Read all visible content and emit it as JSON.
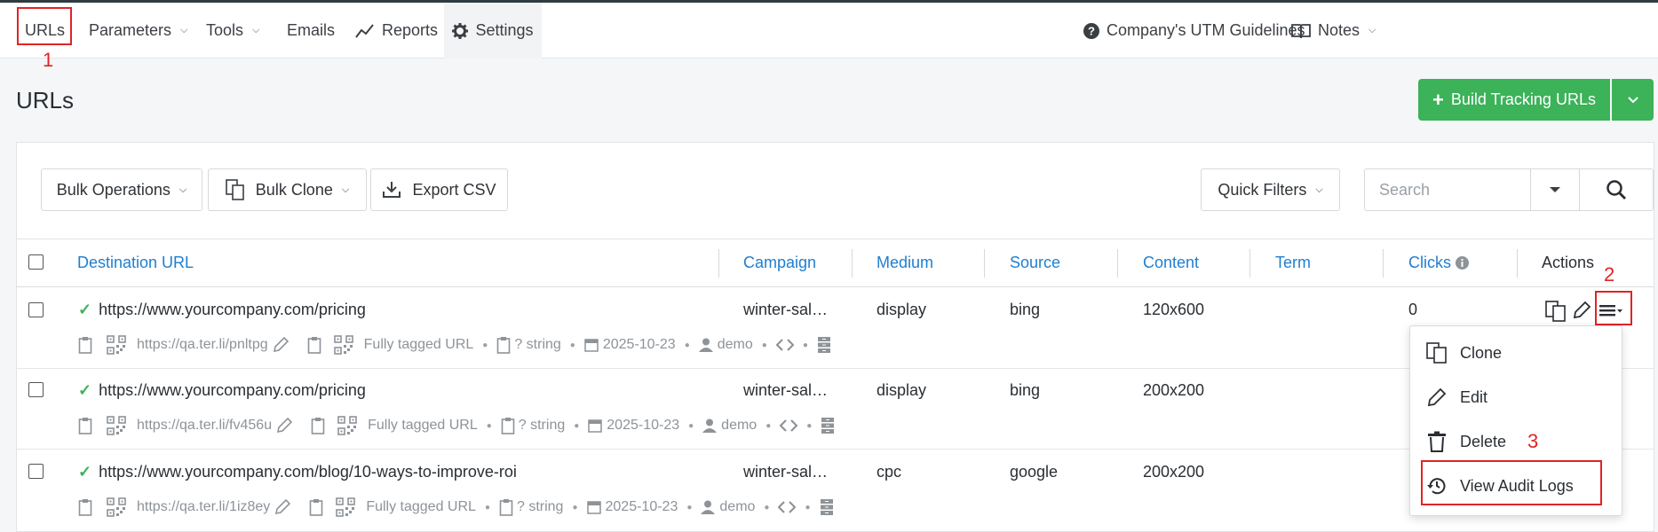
{
  "nav": {
    "urls": "URLs",
    "parameters": "Parameters",
    "tools": "Tools",
    "emails": "Emails",
    "reports": "Reports",
    "settings": "Settings",
    "guidelines": "Company's UTM Guidelines",
    "notes": "Notes"
  },
  "annotations": {
    "n1": "1",
    "n2": "2",
    "n3": "3"
  },
  "page": {
    "title": "URLs",
    "build_label": "Build Tracking URLs"
  },
  "toolbar": {
    "bulk_operations": "Bulk Operations",
    "bulk_clone": "Bulk Clone",
    "export_csv": "Export CSV",
    "quick_filters": "Quick Filters",
    "search_placeholder": "Search"
  },
  "table": {
    "headers": {
      "destination": "Destination URL",
      "campaign": "Campaign",
      "medium": "Medium",
      "source": "Source",
      "content": "Content",
      "term": "Term",
      "clicks": "Clicks",
      "actions": "Actions"
    },
    "rows": [
      {
        "url": "https://www.yourcompany.com/pricing",
        "campaign": "winter-sal…",
        "medium": "display",
        "source": "bing",
        "content": "120x600",
        "term": "",
        "clicks": "0",
        "short": "https://qa.ter.li/pnltpg",
        "tag": "Fully tagged URL",
        "type": "? string",
        "date": "2025-10-23",
        "user": "demo"
      },
      {
        "url": "https://www.yourcompany.com/pricing",
        "campaign": "winter-sal…",
        "medium": "display",
        "source": "bing",
        "content": "200x200",
        "term": "",
        "clicks": "",
        "short": "https://qa.ter.li/fv456u",
        "tag": "Fully tagged URL",
        "type": "? string",
        "date": "2025-10-23",
        "user": "demo"
      },
      {
        "url": "https://www.yourcompany.com/blog/10-ways-to-improve-roi",
        "campaign": "winter-sal…",
        "medium": "cpc",
        "source": "google",
        "content": "200x200",
        "term": "",
        "clicks": "",
        "short": "https://qa.ter.li/1iz8ey",
        "tag": "Fully tagged URL",
        "type": "? string",
        "date": "2025-10-23",
        "user": "demo"
      }
    ]
  },
  "menu": {
    "clone": "Clone",
    "edit": "Edit",
    "delete": "Delete",
    "audit": "View Audit Logs"
  },
  "colors": {
    "accent_green": "#3cb259",
    "link_blue": "#1e7fd0",
    "annotation_red": "#e02424"
  }
}
